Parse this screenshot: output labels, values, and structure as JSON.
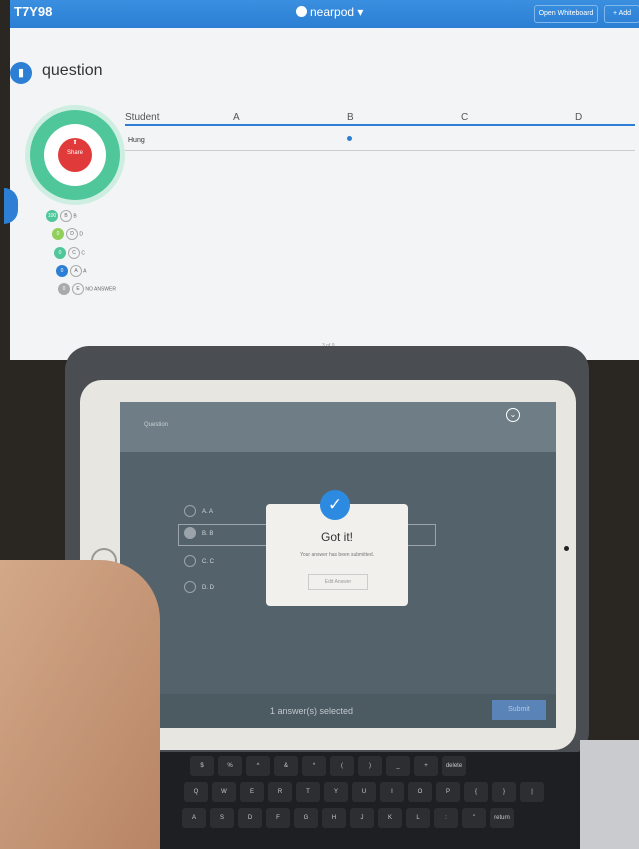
{
  "monitor": {
    "session_code": "T7Y98",
    "brand": "nearpod",
    "buttons": [
      "Open Whiteboard",
      "+ Add"
    ],
    "question_title": "question",
    "share_label": "Share",
    "legend": [
      {
        "badge": "100",
        "letter": "B",
        "text": "B",
        "color": "#4fc79a"
      },
      {
        "badge": "0",
        "letter": "D",
        "text": "D",
        "color": "#8fcf5a"
      },
      {
        "badge": "0",
        "letter": "C",
        "text": "C",
        "color": "#4fc79a"
      },
      {
        "badge": "0",
        "letter": "A",
        "text": "A",
        "color": "#2c7fd4"
      },
      {
        "badge": "0",
        "letter": "E",
        "text": "NO ANSWER",
        "color": "#aaaaaa"
      }
    ],
    "table_headers": [
      "Student",
      "A",
      "B",
      "C",
      "D"
    ],
    "student": "Hung",
    "page": "3 of 9"
  },
  "tablet": {
    "question_label": "Question",
    "options": [
      "A. A",
      "B. B",
      "C. C",
      "D. D"
    ],
    "selected_option": "B. B",
    "modal": {
      "title": "Got it!",
      "message": "Your answer has been submitted.",
      "edit_button": "Edit Answer"
    },
    "footer_count": "1 answer(s) selected",
    "submit_button": "Submit"
  },
  "keyboard_row1": [
    "$",
    "%",
    "^",
    "&",
    "*",
    "(",
    ")",
    "_",
    "+",
    "delete"
  ],
  "keyboard_row2": [
    "Q",
    "W",
    "E",
    "R",
    "T",
    "Y",
    "U",
    "I",
    "O",
    "P",
    "{",
    "}",
    "|"
  ],
  "keyboard_row3": [
    "A",
    "S",
    "D",
    "F",
    "G",
    "H",
    "J",
    "K",
    "L",
    ":",
    "\"",
    "return"
  ]
}
